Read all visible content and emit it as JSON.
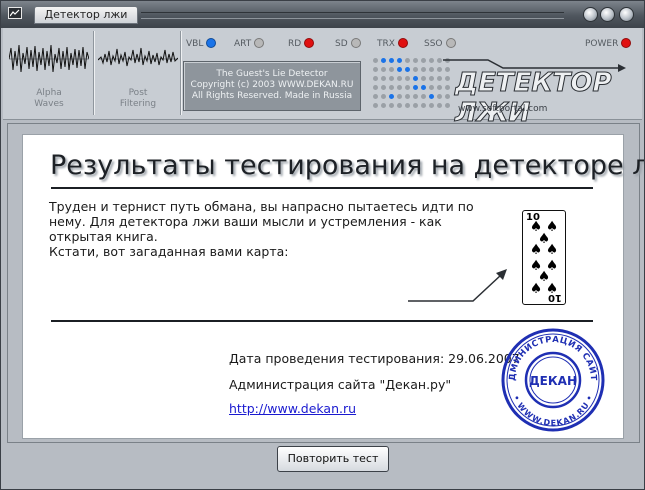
{
  "window": {
    "title": "Детектор лжи"
  },
  "panel": {
    "wave1_label_line1": "Alpha",
    "wave1_label_line2": "Waves",
    "wave2_label_line1": "Post",
    "wave2_label_line2": "Filtering",
    "indicators": [
      {
        "label": "VBL",
        "color": "#1a73e8"
      },
      {
        "label": "ART",
        "color": "#b8b8b8"
      },
      {
        "label": "RD",
        "color": "#e01010"
      },
      {
        "label": "SD",
        "color": "#b8b8b8"
      },
      {
        "label": "TRX",
        "color": "#e01010"
      },
      {
        "label": "SSO",
        "color": "#b8b8b8"
      },
      {
        "label": "POWER",
        "color": "#e01010"
      }
    ],
    "lcd_line1": "The Guest's Lie Detector",
    "lcd_line2": "Copyright (c) 2003 WWW.DEKAN.RU",
    "lcd_line3": "All Rights Reserved. Made in Russia",
    "logo_text": "ДЕТЕКТОР ЛЖИ",
    "logo_url": "www.softportal.com"
  },
  "content": {
    "heading": "Результаты тестирования на детекторе лжи.",
    "message_line1": "Труден и тернист путь обмана, вы напрасно пытаетесь идти по",
    "message_line2": "нему. Для детектора лжи ваши мысли и устремления - как",
    "message_line3": "открытая книга.",
    "message_line4": "Кстати, вот загаданная вами карта:",
    "card_rank": "10",
    "date_line": "Дата проведения тестирования: 29.06.2007",
    "admin_line": "Администрация сайта \"Декан.ру\"",
    "link": "http://www.dekan.ru",
    "stamp_center": "ДЕКАН",
    "stamp_top": "АДМИНИСТРАЦИЯ САЙТА",
    "stamp_bottom": "• WWW.DEKAN.RU •"
  },
  "footer": {
    "repeat_button": "Повторить тест"
  },
  "colors": {
    "accent_blue": "#1a73e8",
    "accent_red": "#e01010",
    "stamp_blue": "#1f2fb3"
  }
}
